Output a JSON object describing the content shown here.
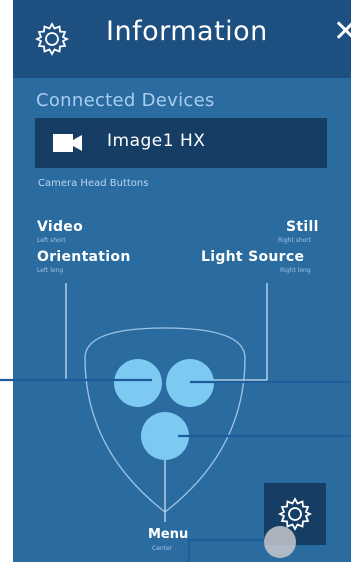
{
  "header": {
    "icon": "gear-icon",
    "title": "Information",
    "close_label": "✕"
  },
  "connected_devices": {
    "title": "Connected Devices",
    "device": {
      "icon": "camera-icon",
      "name": "Image1 HX"
    }
  },
  "camera_head_buttons": {
    "title": "Camera Head Buttons",
    "buttons": [
      {
        "label": "Video",
        "sub": "Left short"
      },
      {
        "label": "Still",
        "sub": "Right short"
      },
      {
        "label": "Orientation",
        "sub": "Left long"
      },
      {
        "label": "Light Source",
        "sub": "Right long"
      },
      {
        "label": "Menu",
        "sub": "Center"
      }
    ]
  },
  "settings_tile": {
    "icon": "gear-icon"
  },
  "colors": {
    "panel": "#2b6ca0",
    "header": "#1d4f80",
    "dark_box": "#163e64",
    "button_circle": "#7cc9f2",
    "callout_line": "#1f5c9a"
  }
}
